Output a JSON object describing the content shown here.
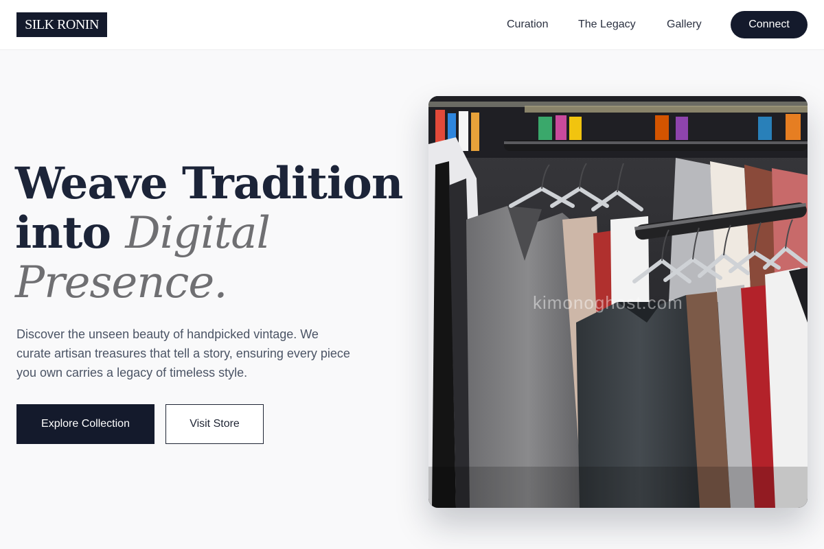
{
  "brand": {
    "logo_text": "SILK RONIN"
  },
  "nav": {
    "items": [
      {
        "label": "Curation"
      },
      {
        "label": "The Legacy"
      },
      {
        "label": "Gallery"
      }
    ],
    "cta_label": "Connect"
  },
  "hero": {
    "title_line1": "Weave Tradition",
    "title_line2_plain": "into ",
    "title_line2_accent": "Digital",
    "title_line3_accent": "Presence.",
    "subtitle": "Discover the unseen beauty of handpicked vintage. We curate artisan treasures that tell a story, ensuring every piece you own carries a legacy of timeless style.",
    "primary_button": "Explore Collection",
    "secondary_button": "Visit Store",
    "image_watermark": "kimonoghost.com"
  },
  "colors": {
    "brand_navy": "#141a2c",
    "accent_gray": "#6f6f72",
    "page_bg": "#f9f9fa"
  }
}
